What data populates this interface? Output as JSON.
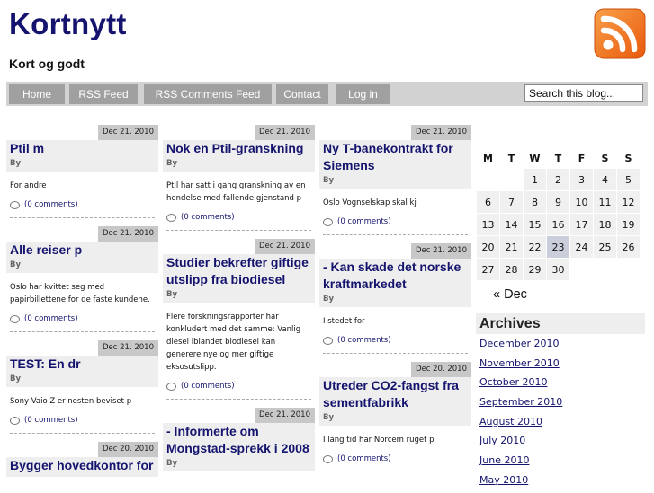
{
  "header": {
    "site_title": "Kortnytt",
    "tagline": "Kort og godt",
    "rss_icon": "rss-feed-icon",
    "rss_color": "#f47a20"
  },
  "nav": {
    "items": [
      {
        "label": "Home"
      },
      {
        "label": "RSS Feed"
      },
      {
        "label": "RSS Comments Feed"
      },
      {
        "label": "Contact"
      },
      {
        "label": "Log in"
      }
    ],
    "search_placeholder": "Search this blog..."
  },
  "columns": [
    [
      {
        "date": "Dec 21. 2010",
        "title": "Ptil m",
        "by": "By",
        "excerpt": "For andre",
        "comments": "(0 comments)"
      },
      {
        "date": "Dec 21. 2010",
        "title": "Alle reiser p",
        "by": "By",
        "excerpt": "Oslo har kvittet seg med papirbillettene for de faste kundene.",
        "comments": "(0 comments)"
      },
      {
        "date": "Dec 21. 2010",
        "title": "TEST: En dr",
        "by": "By",
        "excerpt": "Sony Vaio Z er nesten beviset p",
        "comments": "(0 comments)"
      },
      {
        "date": "Dec 20. 2010",
        "title": "Bygger hovedkontor for",
        "by": "",
        "excerpt": "",
        "comments": ""
      }
    ],
    [
      {
        "date": "Dec 21. 2010",
        "title": "Nok en Ptil-granskning",
        "by": "By",
        "excerpt": "Ptil har satt i gang granskning av en hendelse med fallende gjenstand p",
        "comments": "(0 comments)"
      },
      {
        "date": "Dec 21. 2010",
        "title": "Studier bekrefter giftige utslipp fra biodiesel",
        "by": "By",
        "excerpt": "Flere forskningsrapporter har konkludert med det samme: Vanlig diesel iblandet biodiesel kan generere nye og mer giftige eksosutslipp.",
        "comments": "(0 comments)"
      },
      {
        "date": "Dec 21. 2010",
        "title": "- Informerte om Mongstad-sprekk i 2008",
        "by": "By",
        "excerpt": "",
        "comments": ""
      }
    ],
    [
      {
        "date": "Dec 21. 2010",
        "title": "Ny T-banekontrakt for Siemens",
        "by": "By",
        "excerpt": "Oslo Vognselskap skal kj",
        "comments": "(0 comments)"
      },
      {
        "date": "Dec 21. 2010",
        "title": "- Kan skade det norske kraftmarkedet",
        "by": "By",
        "excerpt": "I stedet for",
        "comments": "(0 comments)"
      },
      {
        "date": "Dec 20. 2010",
        "title": "Utreder CO2-fangst fra sementfabrikk",
        "by": "By",
        "excerpt": "I lang tid har Norcem ruget p",
        "comments": "(0 comments)"
      }
    ]
  ],
  "calendar": {
    "weekdays": [
      "M",
      "T",
      "W",
      "T",
      "F",
      "S",
      "S"
    ],
    "weeks": [
      [
        "",
        "",
        "1",
        "2",
        "3",
        "4",
        "5"
      ],
      [
        "6",
        "7",
        "8",
        "9",
        "10",
        "11",
        "12"
      ],
      [
        "13",
        "14",
        "15",
        "16",
        "17",
        "18",
        "19"
      ],
      [
        "20",
        "21",
        "22",
        "23",
        "24",
        "25",
        "26"
      ],
      [
        "27",
        "28",
        "29",
        "30",
        "",
        "",
        ""
      ]
    ],
    "highlighted_day": "23",
    "prev_link": "« Dec"
  },
  "archives": {
    "heading": "Archives",
    "links": [
      "December 2010",
      "November 2010",
      "October 2010",
      "September 2010",
      "August 2010",
      "July 2010",
      "June 2010",
      "May 2010"
    ]
  },
  "colors": {
    "title_blue": "#14146e",
    "nav_bar": "#d2d2d2",
    "nav_button": "#a0a0a0"
  }
}
